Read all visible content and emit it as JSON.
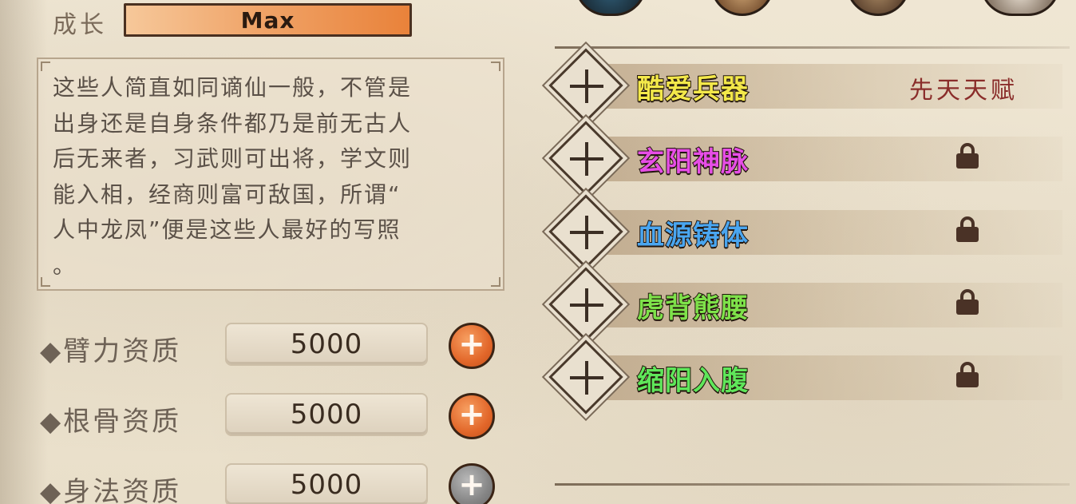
{
  "growth": {
    "label": "成长",
    "value": "Max"
  },
  "description": {
    "lines": [
      "这些人简直如同谪仙一般，不管是",
      "出身还是自身条件都乃是前无古人",
      "后无来者，习武则可出将，学文则",
      "能入相，经商则富可敌国，所谓“",
      "人中龙凤”便是这些人最好的写照",
      "。"
    ]
  },
  "stats": [
    {
      "label": "◆臂力资质",
      "value": "5000",
      "button": "plus-active"
    },
    {
      "label": "◆根骨资质",
      "value": "5000",
      "button": "plus-active"
    },
    {
      "label": "◆身法资质",
      "value": "5000",
      "button": "plus-disabled"
    }
  ],
  "talents": [
    {
      "name": "酷爱兵器",
      "color": "#f3e84a",
      "tag": "先天天赋",
      "locked": false
    },
    {
      "name": "玄阳神脉",
      "color": "#e64ee6",
      "tag": "",
      "locked": true
    },
    {
      "name": "血源铸体",
      "color": "#4aa6f0",
      "tag": "",
      "locked": true
    },
    {
      "name": "虎背熊腰",
      "color": "#7ee24a",
      "tag": "",
      "locked": true
    },
    {
      "name": "缩阳入腹",
      "color": "#5fe65a",
      "tag": "",
      "locked": true
    }
  ],
  "colors": {
    "growth_bar_start": "#f6c89a",
    "growth_bar_end": "#e9823a",
    "plus_active": "#e2672a",
    "plus_disabled": "#858585",
    "talent_tag": "#8a2d2a"
  },
  "icons": {
    "slot_icon": "cross-icon",
    "lock_icon": "lock-icon",
    "plus_icon": "plus-icon"
  }
}
